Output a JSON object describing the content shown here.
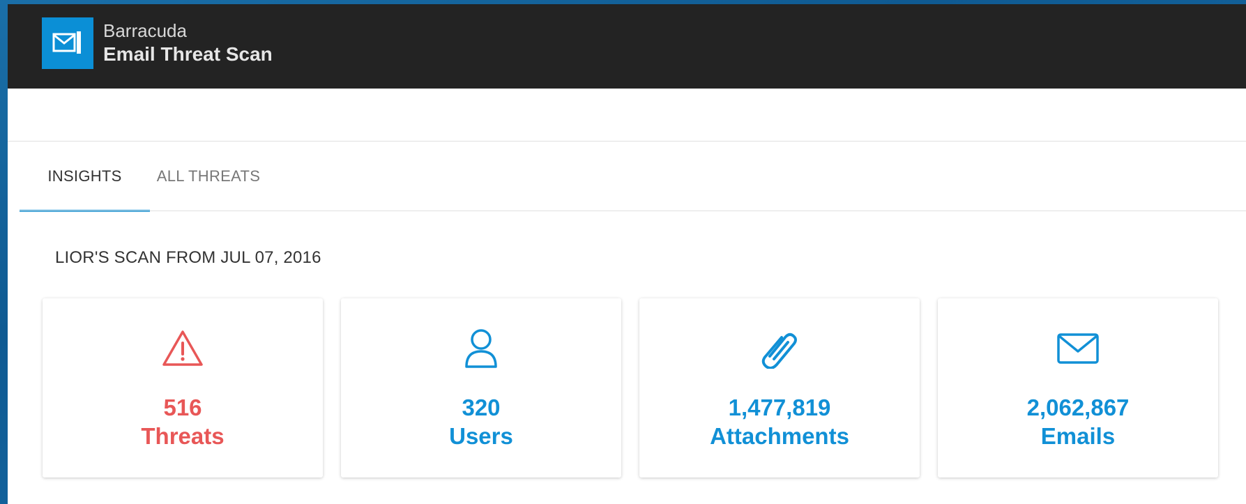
{
  "app": {
    "brand_line1": "Barracuda",
    "brand_line2": "Email Threat Scan",
    "logo_icon": "envelope-logo-icon",
    "brand_color": "#0b8fd6"
  },
  "tabs": [
    {
      "label": "INSIGHTS",
      "active": true
    },
    {
      "label": "ALL THREATS",
      "active": false
    }
  ],
  "scan": {
    "title": "LIOR'S SCAN FROM JUL 07, 2016"
  },
  "stats": [
    {
      "value": "516",
      "label": "Threats",
      "icon": "warning-triangle-icon",
      "color": "#e85757"
    },
    {
      "value": "320",
      "label": "Users",
      "icon": "user-icon",
      "color": "#1190d6"
    },
    {
      "value": "1,477,819",
      "label": "Attachments",
      "icon": "paperclip-icon",
      "color": "#1190d6"
    },
    {
      "value": "2,062,867",
      "label": "Emails",
      "icon": "envelope-icon",
      "color": "#1190d6"
    }
  ]
}
